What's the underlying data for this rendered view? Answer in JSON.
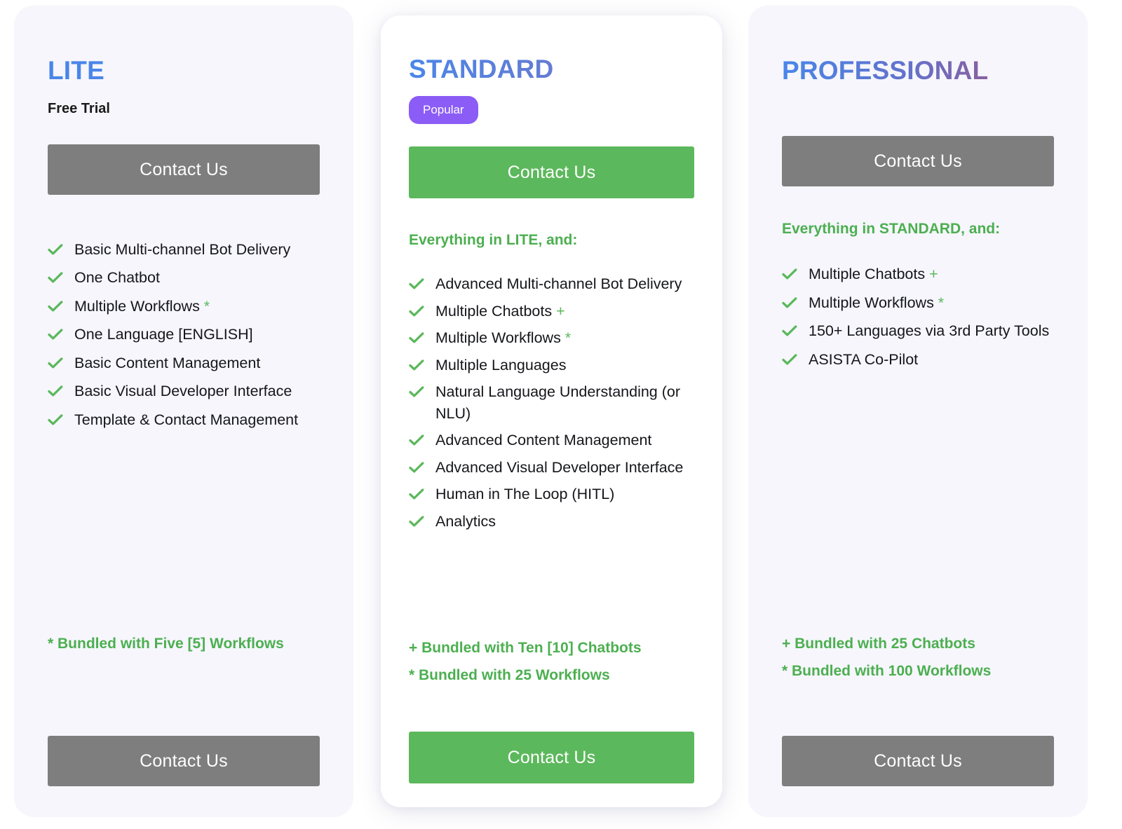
{
  "plans": [
    {
      "id": "lite",
      "name": "LITE",
      "subtitle": "Free Trial",
      "badge": null,
      "everything_heading": null,
      "cta_top_label": "Contact Us",
      "cta_bottom_label": "Contact Us",
      "cta_style": "gray",
      "features": [
        {
          "text": "Basic Multi-channel Bot Delivery",
          "marker": ""
        },
        {
          "text": "One Chatbot",
          "marker": ""
        },
        {
          "text": "Multiple Workflows",
          "marker": "*"
        },
        {
          "text": "One Language [ENGLISH]",
          "marker": ""
        },
        {
          "text": "Basic Content Management",
          "marker": ""
        },
        {
          "text": "Basic Visual Developer Interface",
          "marker": ""
        },
        {
          "text": "Template & Contact Management",
          "marker": ""
        }
      ],
      "footnotes": [
        "* Bundled with Five [5] Workflows"
      ]
    },
    {
      "id": "standard",
      "name": "STANDARD",
      "subtitle": null,
      "badge": "Popular",
      "everything_heading": "Everything in LITE, and:",
      "cta_top_label": "Contact Us",
      "cta_bottom_label": "Contact Us",
      "cta_style": "green",
      "features": [
        {
          "text": "Advanced Multi-channel Bot Delivery",
          "marker": ""
        },
        {
          "text": "Multiple Chatbots",
          "marker": "+"
        },
        {
          "text": "Multiple Workflows",
          "marker": "*"
        },
        {
          "text": "Multiple Languages",
          "marker": ""
        },
        {
          "text": "Natural Language Understanding (or NLU)",
          "marker": ""
        },
        {
          "text": "Advanced Content Management",
          "marker": ""
        },
        {
          "text": "Advanced Visual Developer Interface",
          "marker": ""
        },
        {
          "text": "Human in The Loop (HITL)",
          "marker": ""
        },
        {
          "text": "Analytics",
          "marker": ""
        }
      ],
      "footnotes": [
        "+ Bundled with Ten [10] Chatbots",
        "* Bundled with 25 Workflows"
      ]
    },
    {
      "id": "professional",
      "name": "PROFESSIONAL",
      "subtitle": null,
      "badge": null,
      "everything_heading": "Everything in STANDARD, and:",
      "cta_top_label": "Contact Us",
      "cta_bottom_label": "Contact Us",
      "cta_style": "gray",
      "features": [
        {
          "text": "Multiple Chatbots",
          "marker": "+"
        },
        {
          "text": "Multiple Workflows",
          "marker": "*"
        },
        {
          "text": "150+ Languages via 3rd Party Tools",
          "marker": ""
        },
        {
          "text": "ASISTA Co-Pilot",
          "marker": ""
        }
      ],
      "footnotes": [
        "+ Bundled with 25 Chatbots",
        "* Bundled with 100 Workflows"
      ]
    }
  ],
  "icons": {
    "check": "check-icon"
  },
  "colors": {
    "accent_green": "#5cb85c",
    "heading_green": "#4caf50",
    "badge_purple": "#8b5cf6",
    "button_gray": "#7e7e7e",
    "title_blue": "#4a86e8",
    "title_purple": "#9c4f86",
    "card_muted_bg": "#f6f6fc",
    "card_featured_bg": "#ffffff"
  }
}
